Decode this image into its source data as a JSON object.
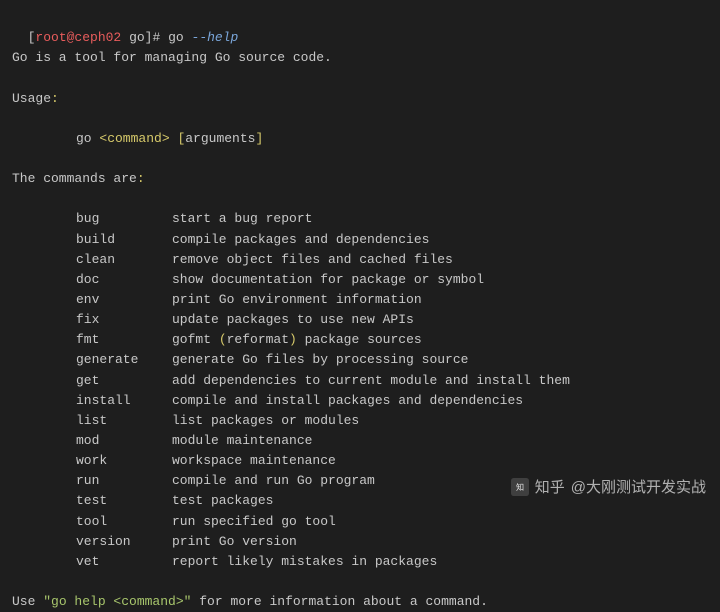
{
  "prompt": {
    "open": "[",
    "userhost": "root@ceph02",
    "sep": " ",
    "cwd": "go",
    "close": "]#",
    "bin": "go",
    "flag": "--help"
  },
  "intro": "Go is a tool for managing Go source code.",
  "usage_label": "Usage",
  "usage_colon": ":",
  "usage_line_pre": "go ",
  "usage_cmd": "<command>",
  "usage_mid": " ",
  "usage_args_open": "[",
  "usage_args_txt": "arguments",
  "usage_args_close": "]",
  "commands_label_pre": "The commands are",
  "commands_colon": ":",
  "commands": [
    {
      "name": "bug",
      "desc": "start a bug report"
    },
    {
      "name": "build",
      "desc": "compile packages and dependencies"
    },
    {
      "name": "clean",
      "desc": "remove object files and cached files"
    },
    {
      "name": "doc",
      "desc": "show documentation for package or symbol"
    },
    {
      "name": "env",
      "desc": "print Go environment information"
    },
    {
      "name": "fix",
      "desc": "update packages to use new APIs"
    },
    {
      "name": "fmt",
      "desc_pre": "gofmt ",
      "paren_open": "(",
      "desc_mid": "reformat",
      "paren_close": ")",
      "desc_post": " package sources"
    },
    {
      "name": "generate",
      "desc": "generate Go files by processing source"
    },
    {
      "name": "get",
      "desc": "add dependencies to current module and install them"
    },
    {
      "name": "install",
      "desc": "compile and install packages and dependencies"
    },
    {
      "name": "list",
      "desc": "list packages or modules"
    },
    {
      "name": "mod",
      "desc": "module maintenance"
    },
    {
      "name": "work",
      "desc": "workspace maintenance"
    },
    {
      "name": "run",
      "desc": "compile and run Go program"
    },
    {
      "name": "test",
      "desc": "test packages"
    },
    {
      "name": "tool",
      "desc": "run specified go tool"
    },
    {
      "name": "version",
      "desc": "print Go version"
    },
    {
      "name": "vet",
      "desc": "report likely mistakes in packages"
    }
  ],
  "footer_pre": "Use ",
  "footer_str": "\"go help <command>\"",
  "footer_post": " for more information about a command.",
  "watermark": {
    "prefix": "知乎",
    "handle": "@大刚测试开发实战"
  }
}
